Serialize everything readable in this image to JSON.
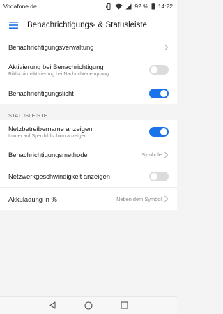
{
  "status_bar": {
    "carrier": "Vodafone.de",
    "battery_percent": "92 %",
    "time": "14:22",
    "icons": [
      "vibrate-icon",
      "wifi-icon",
      "signal-icon",
      "battery-icon"
    ]
  },
  "header": {
    "title": "Benachrichtigungs- & Statusleiste",
    "menu_icon": "hamburger-menu-icon"
  },
  "section1": {
    "items": [
      {
        "label": "Benachrichtigungsverwaltung",
        "control": "chevron"
      },
      {
        "label": "Aktivierung bei Benachrichtigung",
        "sublabel": "Bildschirmaktivierung bei Nachrichtenempfang",
        "control": "toggle",
        "on": false
      },
      {
        "label": "Benachrichtigungslicht",
        "control": "toggle",
        "on": true
      }
    ]
  },
  "section2": {
    "header": "STATUSLEISTE",
    "items": [
      {
        "label": "Netzbetreibername anzeigen",
        "sublabel": "Immer auf Sperrbildschirm anzeigen",
        "control": "toggle",
        "on": true
      },
      {
        "label": "Benachrichtigungsmethode",
        "value": "Symbole",
        "control": "chevron"
      },
      {
        "label": "Netzwerkgeschwindigkeit anzeigen",
        "control": "toggle",
        "on": false
      },
      {
        "label": "Akkuladung in %",
        "value": "Neben dem Symbol",
        "control": "chevron"
      }
    ]
  },
  "nav_bar": {
    "icons": [
      "back-icon",
      "home-icon",
      "recents-icon"
    ]
  },
  "colors": {
    "accent": "#1a73e8",
    "toggle_off": "#dcdcdc",
    "background": "#f4f4f4"
  }
}
